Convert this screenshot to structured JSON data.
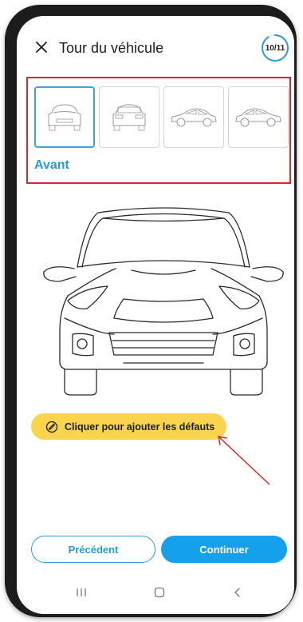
{
  "header": {
    "title": "Tour du véhicule",
    "progress_text": "10/11",
    "progress_value": 0.909
  },
  "thumbnails": [
    {
      "view": "front",
      "selected": true
    },
    {
      "view": "rear",
      "selected": false
    },
    {
      "view": "left-side",
      "selected": false
    },
    {
      "view": "right-side",
      "selected": false
    }
  ],
  "current_view_label": "Avant",
  "defect_button": {
    "label": "Cliquer pour ajouter les défauts",
    "icon": "pencil-circle-icon"
  },
  "footer": {
    "prev_label": "Précédent",
    "next_label": "Continuer"
  },
  "navbar": {
    "items": [
      "recent-apps-icon",
      "home-icon",
      "back-icon"
    ]
  },
  "colors": {
    "accent_blue": "#15a0ec",
    "label_blue": "#2a9ad6",
    "defect_yellow": "#fbd44f",
    "highlight_red": "#e0262b"
  }
}
